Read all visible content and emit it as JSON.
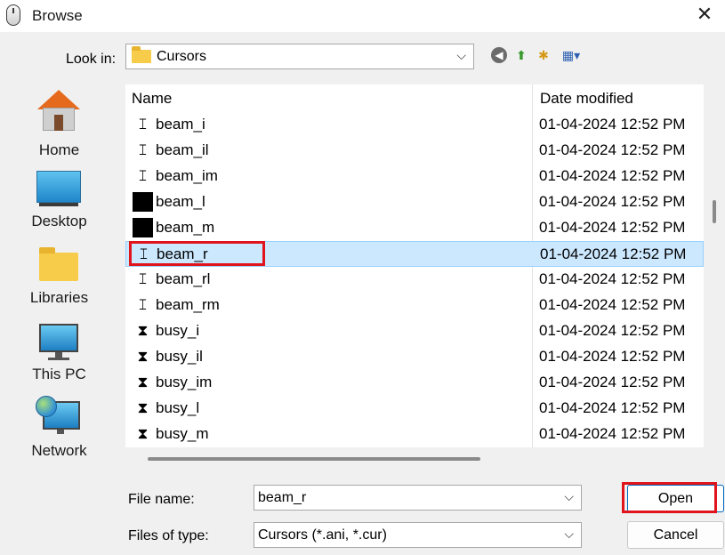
{
  "window": {
    "title": "Browse",
    "close_glyph": "✕"
  },
  "lookin": {
    "label": "Look in:",
    "value": "Cursors",
    "arrow": "⌵"
  },
  "toolbar": {
    "back_glyph": "◀",
    "up_glyph": "⬆",
    "newfolder_glyph": "✱",
    "view_glyph": "▦▾"
  },
  "places": [
    {
      "label": "Home",
      "icon": "home-icon"
    },
    {
      "label": "Desktop",
      "icon": "desktop-icon"
    },
    {
      "label": "Libraries",
      "icon": "libraries-icon"
    },
    {
      "label": "This PC",
      "icon": "this-pc-icon"
    },
    {
      "label": "Network",
      "icon": "network-icon"
    }
  ],
  "columns": {
    "name": "Name",
    "date": "Date modified"
  },
  "files": [
    {
      "name": "beam_i",
      "date": "01-04-2024 12:52 PM",
      "glyph": "𝙸"
    },
    {
      "name": "beam_il",
      "date": "01-04-2024 12:52 PM",
      "glyph": "𝙸"
    },
    {
      "name": "beam_im",
      "date": "01-04-2024 12:52 PM",
      "glyph": "𝙸"
    },
    {
      "name": "beam_l",
      "date": "01-04-2024 12:52 PM",
      "glyph": ""
    },
    {
      "name": "beam_m",
      "date": "01-04-2024 12:52 PM",
      "glyph": ""
    },
    {
      "name": "beam_r",
      "date": "01-04-2024 12:52 PM",
      "glyph": "𝙸"
    },
    {
      "name": "beam_rl",
      "date": "01-04-2024 12:52 PM",
      "glyph": "𝙸"
    },
    {
      "name": "beam_rm",
      "date": "01-04-2024 12:52 PM",
      "glyph": "𝙸"
    },
    {
      "name": "busy_i",
      "date": "01-04-2024 12:52 PM",
      "glyph": "⧗"
    },
    {
      "name": "busy_il",
      "date": "01-04-2024 12:52 PM",
      "glyph": "⧗"
    },
    {
      "name": "busy_im",
      "date": "01-04-2024 12:52 PM",
      "glyph": "⧗"
    },
    {
      "name": "busy_l",
      "date": "01-04-2024 12:52 PM",
      "glyph": "⧗"
    },
    {
      "name": "busy_m",
      "date": "01-04-2024 12:52 PM",
      "glyph": "⧗"
    }
  ],
  "form": {
    "filename_label": "File name:",
    "filename_value": "beam_r",
    "filetype_label": "Files of type:",
    "filetype_value": "Cursors (*.ani, *.cur)",
    "open_label": "Open",
    "cancel_label": "Cancel"
  },
  "colors": {
    "selection": "#cce8ff",
    "highlight": "#e0141c",
    "accent": "#0067c0"
  }
}
